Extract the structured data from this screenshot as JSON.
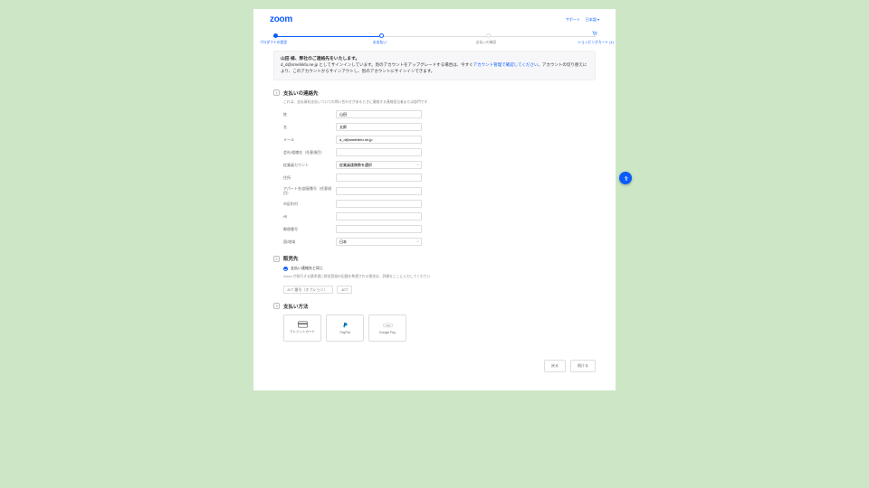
{
  "brand": "zoom",
  "topnav": {
    "support": "サポート",
    "lang": "日本語 ▾"
  },
  "steps": [
    {
      "label": "プロダクトの設定",
      "pos": 0
    },
    {
      "label": "お支払い",
      "pos": 33
    },
    {
      "label": "支払いの確認",
      "pos": 66
    },
    {
      "label": "ショッピングカート (1)",
      "pos": 100
    }
  ],
  "banner": {
    "title": "山田 様、弊社のご連絡先をいたします。",
    "body1": "d_d@smehikfu.ne.jp としてサインインしています。別のアカウントをアップグレードする場合は、今すぐ",
    "link": "アカウント管理で確認してください",
    "body2": "。アカウントの切り替えにより、このアカウントからサインアウトし、別のアカウントにサインインできます。"
  },
  "sec1": {
    "num": "1",
    "title": "支払いの連絡先",
    "sub": "これは、支払資料支払いついての問い合わせがあるときに連絡する連絡担当者または部門です",
    "fields": {
      "last": {
        "label": "姓",
        "val": "山田"
      },
      "first": {
        "label": "名",
        "val": "太郎"
      },
      "email": {
        "label": "メール",
        "val": "d_d@smehikfu.ne.jp"
      },
      "company": {
        "label": "会社/組織名（任意項目）",
        "val": ""
      },
      "accttype": {
        "label": "従業員カウント",
        "val": "従業員連携数を選択"
      },
      "addr": {
        "label": "住所",
        "val": ""
      },
      "apt": {
        "label": "アパート名/部屋番号（任意項目）",
        "val": ""
      },
      "city": {
        "label": "市区町村",
        "val": ""
      },
      "state": {
        "label": "州",
        "val": ""
      },
      "zip": {
        "label": "郵便番号",
        "val": ""
      },
      "country": {
        "label": "国/地域",
        "val": "日本"
      }
    }
  },
  "sec2": {
    "num": "2",
    "title": "販売先",
    "radio": "支払い連絡先と同じ",
    "sub": "Zoom が発行する請求書に税金登録の記載を希望される場合は、詳細をここに入力してください",
    "tax_ph": "JCT 番号（オプション）",
    "tax_btn": "JCT"
  },
  "sec3": {
    "num": "3",
    "title": "支払い方法",
    "methods": [
      "クレジットカード",
      "PayPal",
      "Google Pay"
    ]
  },
  "footer": {
    "back": "戻る",
    "next": "続ける"
  }
}
